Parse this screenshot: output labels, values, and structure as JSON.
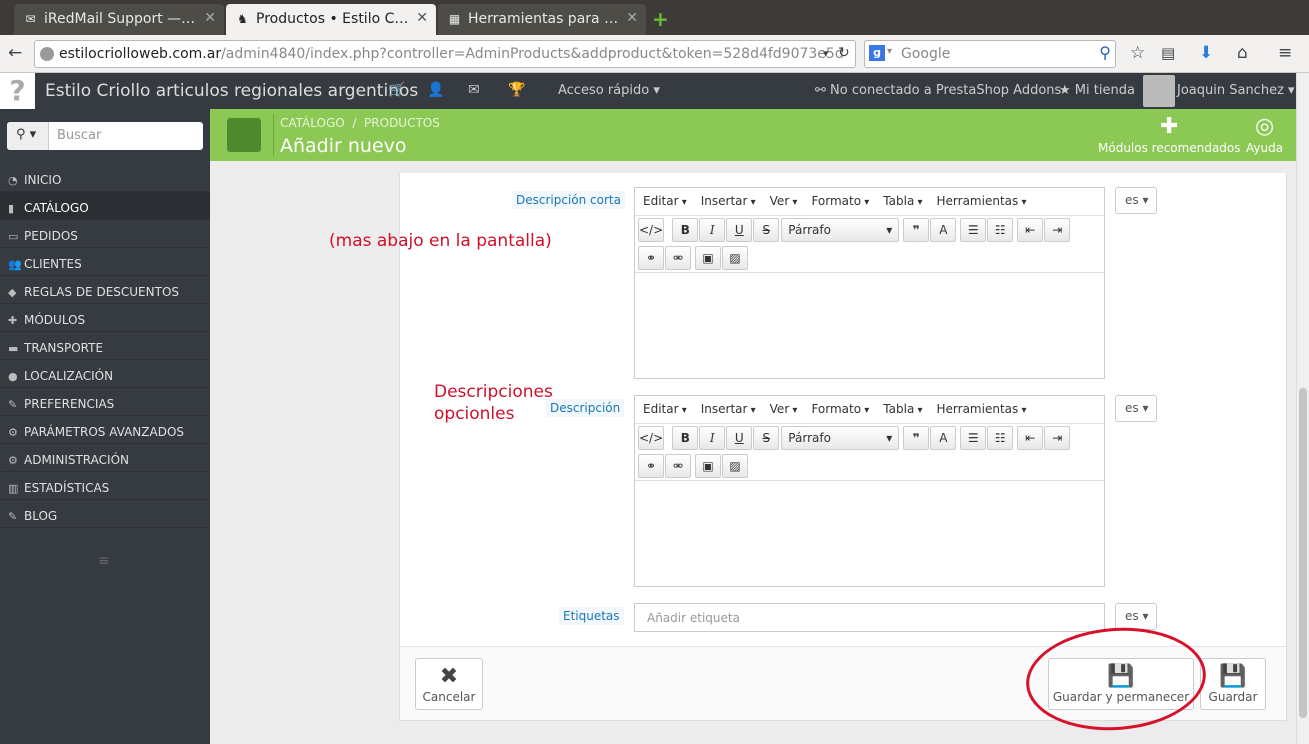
{
  "browser": {
    "tabs": [
      {
        "title": "iRedMail Support —…",
        "icon": "mail-icon"
      },
      {
        "title": "Productos • Estilo C…",
        "icon": "prestashop-icon"
      },
      {
        "title": "Herramientas para …",
        "icon": "calendar-icon"
      }
    ],
    "url_host": "estilocriolloweb.com.ar",
    "url_path": "/admin4840/index.php?controller=AdminProducts&addproduct&token=528d4fd9073e5d",
    "search_placeholder": "Google"
  },
  "header": {
    "shop_name": "Estilo Criollo articulos regionales argentinos",
    "quick_access": "Acceso rápido",
    "addons_status": "No conectado a PrestaShop Addons",
    "my_shop": "Mi tienda",
    "user": "Joaquin Sanchez"
  },
  "toolbar": {
    "breadcrumb_1": "CATÁLOGO",
    "breadcrumb_sep": "/",
    "breadcrumb_2": "PRODUCTOS",
    "title": "Añadir nuevo",
    "modules_label": "Módulos recomendados",
    "help_label": "Ayuda"
  },
  "sidebar": {
    "search_placeholder": "Buscar",
    "items": [
      {
        "label": "INICIO",
        "icon": "tachometer-icon"
      },
      {
        "label": "CATÁLOGO",
        "icon": "book-icon"
      },
      {
        "label": "PEDIDOS",
        "icon": "credit-card-icon"
      },
      {
        "label": "CLIENTES",
        "icon": "users-icon"
      },
      {
        "label": "REGLAS DE DESCUENTOS",
        "icon": "tag-icon"
      },
      {
        "label": "MÓDULOS",
        "icon": "puzzle-icon"
      },
      {
        "label": "TRANSPORTE",
        "icon": "truck-icon"
      },
      {
        "label": "LOCALIZACIÓN",
        "icon": "globe-icon"
      },
      {
        "label": "PREFERENCIAS",
        "icon": "wrench-icon"
      },
      {
        "label": "PARÁMETROS AVANZADOS",
        "icon": "cogs-icon"
      },
      {
        "label": "ADMINISTRACIÓN",
        "icon": "cog-icon"
      },
      {
        "label": "ESTADÍSTICAS",
        "icon": "bar-chart-icon"
      },
      {
        "label": "BLOG",
        "icon": "edit-icon"
      }
    ]
  },
  "form": {
    "short_desc_label": "Descripción corta",
    "desc_label": "Descripción",
    "tags_label": "Etiquetas",
    "tags_placeholder": "Añadir etiqueta",
    "lang": "es",
    "editor_menu": [
      "Editar",
      "Insertar",
      "Ver",
      "Formato",
      "Tabla",
      "Herramientas"
    ],
    "format_select": "Párrafo"
  },
  "footer": {
    "cancel": "Cancelar",
    "save_stay": "Guardar y permanecer",
    "save": "Guardar"
  },
  "annotations": {
    "note_1": "(mas abajo en la pantalla)",
    "note_2_line1": "Descripciones",
    "note_2_line2": "opcionles",
    "highlight_color": "#d8102a"
  }
}
